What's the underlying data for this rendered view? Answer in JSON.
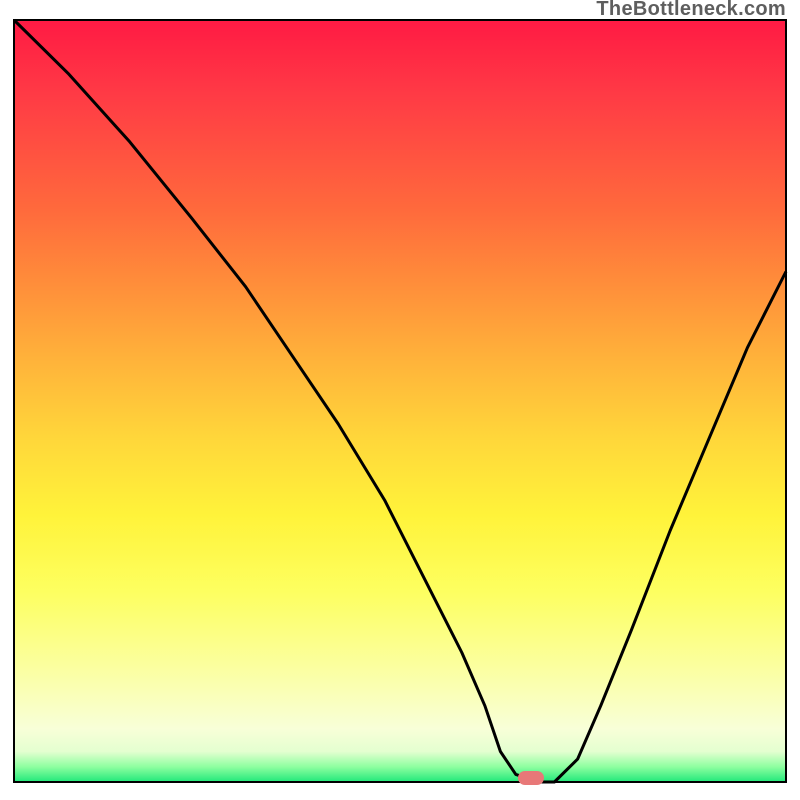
{
  "watermark": "TheBottleneck.com",
  "chart_data": {
    "type": "line",
    "title": "",
    "xlabel": "",
    "ylabel": "",
    "xlim": [
      0,
      100
    ],
    "ylim": [
      0,
      100
    ],
    "grid": false,
    "legend": false,
    "series": [
      {
        "name": "curve",
        "x": [
          0,
          7,
          15,
          23,
          30,
          36,
          42,
          48,
          53,
          58,
          61,
          63,
          65,
          68,
          70,
          73,
          76,
          80,
          85,
          90,
          95,
          100
        ],
        "values": [
          100,
          93,
          84,
          74,
          65,
          56,
          47,
          37,
          27,
          17,
          10,
          4,
          1,
          0,
          0,
          3,
          10,
          20,
          33,
          45,
          57,
          67
        ]
      }
    ],
    "marker": {
      "x": 67,
      "y": 0.5
    },
    "background_gradient": {
      "top": "#ff1a44",
      "mid": "#fff33a",
      "bottom": "#20e87a"
    },
    "colors": {
      "curve": "#000000",
      "marker": "#e87878",
      "frame": "#000000"
    }
  }
}
